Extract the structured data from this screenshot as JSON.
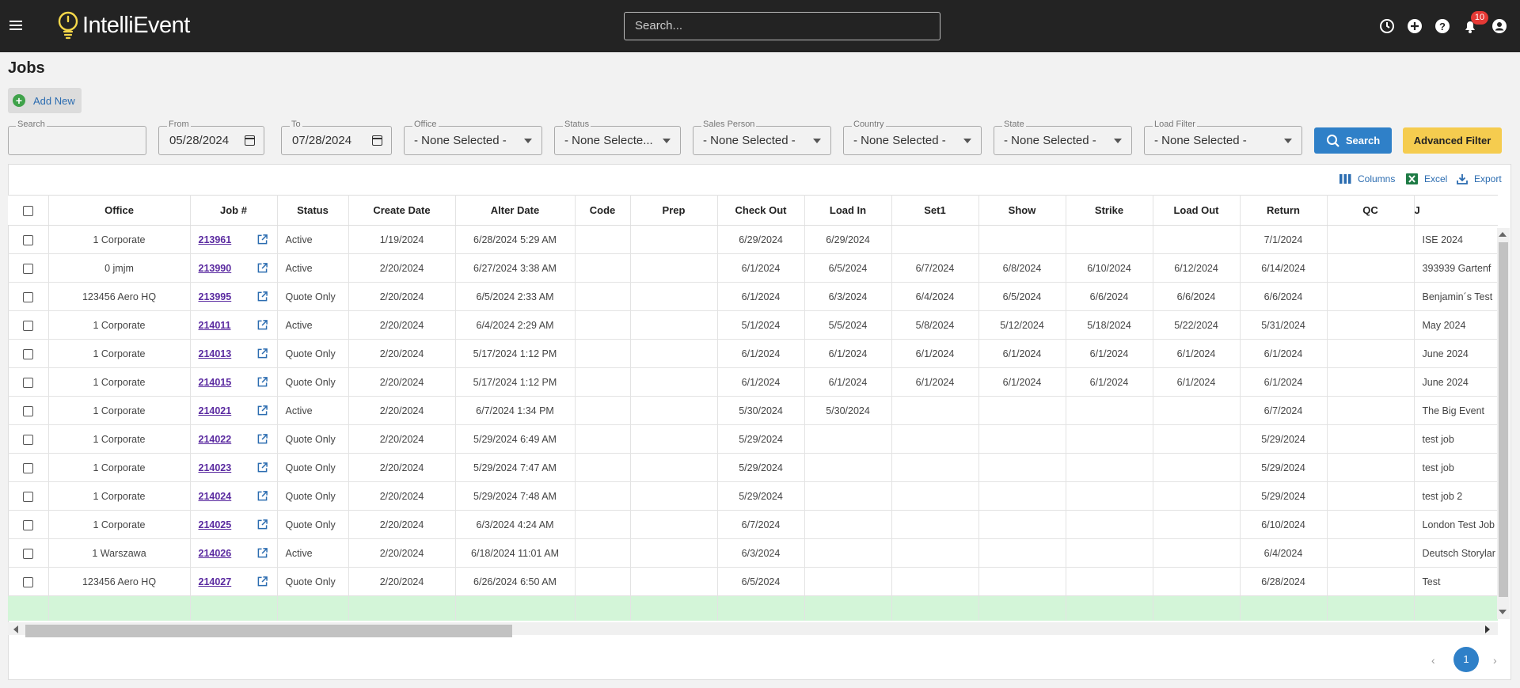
{
  "app": {
    "name": "IntelliEvent"
  },
  "topbar": {
    "search_placeholder": "Search...",
    "notification_count": "10",
    "icons": [
      "menu-icon",
      "history-icon",
      "add-circle-icon",
      "help-icon",
      "bell-icon",
      "account-icon"
    ]
  },
  "page": {
    "title": "Jobs",
    "add_new_label": "Add New"
  },
  "filters": {
    "search": {
      "label": "Search",
      "value": ""
    },
    "from": {
      "label": "From",
      "value": "05/28/2024"
    },
    "to": {
      "label": "To",
      "value": "07/28/2024"
    },
    "office": {
      "label": "Office",
      "value": "- None Selected -"
    },
    "status": {
      "label": "Status",
      "value": "- None Selecte..."
    },
    "sales_person": {
      "label": "Sales Person",
      "value": "- None Selected -"
    },
    "country": {
      "label": "Country",
      "value": "- None Selected -"
    },
    "state": {
      "label": "State",
      "value": "- None Selected -"
    },
    "load_filter": {
      "label": "Load Filter",
      "value": "- None Selected -"
    },
    "search_button": "Search",
    "advanced_button": "Advanced Filter"
  },
  "grid_toolbar": {
    "columns": "Columns",
    "excel": "Excel",
    "export": "Export"
  },
  "table": {
    "columns": [
      "Office",
      "Job #",
      "Status",
      "Create Date",
      "Alter Date",
      "Code",
      "Prep",
      "Check Out",
      "Load In",
      "Set1",
      "Show",
      "Strike",
      "Load Out",
      "Return",
      "QC",
      "J"
    ],
    "rows": [
      [
        "1 Corporate",
        "213961",
        "Active",
        "1/19/2024",
        "6/28/2024 5:29 AM",
        "",
        "",
        "6/29/2024",
        "6/29/2024",
        "",
        "",
        "",
        "",
        "7/1/2024",
        "",
        "ISE 2024"
      ],
      [
        "0 jmjm",
        "213990",
        "Active",
        "2/20/2024",
        "6/27/2024 3:38 AM",
        "",
        "",
        "6/1/2024",
        "6/5/2024",
        "6/7/2024",
        "6/8/2024",
        "6/10/2024",
        "6/12/2024",
        "6/14/2024",
        "",
        "393939 Gartenf"
      ],
      [
        "123456 Aero HQ",
        "213995",
        "Quote Only",
        "2/20/2024",
        "6/5/2024 2:33 AM",
        "",
        "",
        "6/1/2024",
        "6/3/2024",
        "6/4/2024",
        "6/5/2024",
        "6/6/2024",
        "6/6/2024",
        "6/6/2024",
        "",
        "Benjamin´s Test"
      ],
      [
        "1 Corporate",
        "214011",
        "Active",
        "2/20/2024",
        "6/4/2024 2:29 AM",
        "",
        "",
        "5/1/2024",
        "5/5/2024",
        "5/8/2024",
        "5/12/2024",
        "5/18/2024",
        "5/22/2024",
        "5/31/2024",
        "",
        "May 2024"
      ],
      [
        "1 Corporate",
        "214013",
        "Quote Only",
        "2/20/2024",
        "5/17/2024 1:12 PM",
        "",
        "",
        "6/1/2024",
        "6/1/2024",
        "6/1/2024",
        "6/1/2024",
        "6/1/2024",
        "6/1/2024",
        "6/1/2024",
        "",
        "June 2024"
      ],
      [
        "1 Corporate",
        "214015",
        "Quote Only",
        "2/20/2024",
        "5/17/2024 1:12 PM",
        "",
        "",
        "6/1/2024",
        "6/1/2024",
        "6/1/2024",
        "6/1/2024",
        "6/1/2024",
        "6/1/2024",
        "6/1/2024",
        "",
        "June 2024"
      ],
      [
        "1 Corporate",
        "214021",
        "Active",
        "2/20/2024",
        "6/7/2024 1:34 PM",
        "",
        "",
        "5/30/2024",
        "5/30/2024",
        "",
        "",
        "",
        "",
        "6/7/2024",
        "",
        "The Big Event"
      ],
      [
        "1 Corporate",
        "214022",
        "Quote Only",
        "2/20/2024",
        "5/29/2024 6:49 AM",
        "",
        "",
        "5/29/2024",
        "",
        "",
        "",
        "",
        "",
        "5/29/2024",
        "",
        "test job"
      ],
      [
        "1 Corporate",
        "214023",
        "Quote Only",
        "2/20/2024",
        "5/29/2024 7:47 AM",
        "",
        "",
        "5/29/2024",
        "",
        "",
        "",
        "",
        "",
        "5/29/2024",
        "",
        "test job"
      ],
      [
        "1 Corporate",
        "214024",
        "Quote Only",
        "2/20/2024",
        "5/29/2024 7:48 AM",
        "",
        "",
        "5/29/2024",
        "",
        "",
        "",
        "",
        "",
        "5/29/2024",
        "",
        "test job 2"
      ],
      [
        "1 Corporate",
        "214025",
        "Quote Only",
        "2/20/2024",
        "6/3/2024 4:24 AM",
        "",
        "",
        "6/7/2024",
        "",
        "",
        "",
        "",
        "",
        "6/10/2024",
        "",
        "London Test Job"
      ],
      [
        "1 Warszawa",
        "214026",
        "Active",
        "2/20/2024",
        "6/18/2024 11:01 AM",
        "",
        "",
        "6/3/2024",
        "",
        "",
        "",
        "",
        "",
        "6/4/2024",
        "",
        "Deutsch Storylar"
      ],
      [
        "123456 Aero HQ",
        "214027",
        "Quote Only",
        "2/20/2024",
        "6/26/2024 6:50 AM",
        "",
        "",
        "6/5/2024",
        "",
        "",
        "",
        "",
        "",
        "6/28/2024",
        "",
        "Test"
      ]
    ]
  },
  "pager": {
    "current": "1",
    "prev": "‹",
    "next": "›"
  },
  "colors": {
    "topbar": "#232323",
    "accent": "#2f80c8",
    "advanced": "#f5cc4f",
    "add": "#3fa24a",
    "badge": "#e53935",
    "empty_row": "#d3f5d8"
  }
}
